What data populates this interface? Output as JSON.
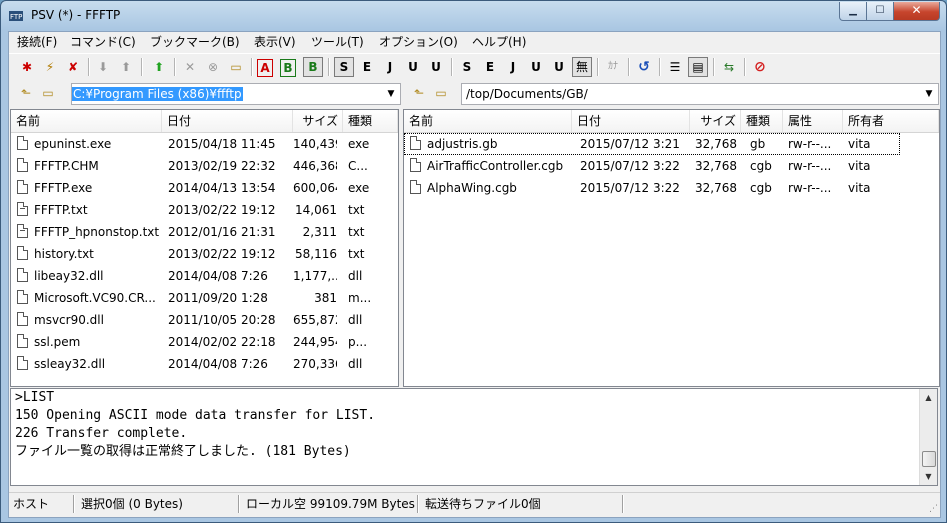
{
  "window": {
    "title": "PSV (*) - FFFTP"
  },
  "menu": [
    "接続(F)",
    "コマンド(C)",
    "ブックマーク(B)",
    "表示(V)",
    "ツール(T)",
    "オプション(O)",
    "ヘルプ(H)"
  ],
  "toolbar": {
    "glyphs": [
      "✱",
      "⚡",
      "✘",
      "⬇",
      "⬆",
      "⬆",
      "✕",
      "⊗",
      "▭",
      "A",
      "B",
      "B",
      "S",
      "E",
      "J",
      "U",
      "U",
      "S",
      "E",
      "J",
      "U",
      "U",
      "無",
      "ｶﾅ",
      "↺",
      "☰",
      "▤",
      "⇆",
      "⊘"
    ],
    "colors": {
      "connect": "#cc0000",
      "green": "#22a322",
      "refresh": "#1a4fb8",
      "stop": "#d42020"
    }
  },
  "local": {
    "path": "C:¥Program Files (x86)¥ffftp",
    "columns": {
      "name": "名前",
      "date": "日付",
      "size": "サイズ",
      "type": "種類"
    },
    "files": [
      {
        "name": "epuninst.exe",
        "date": "2015/04/18 11:45",
        "size": "140,439",
        "type": "exe",
        "icon": "file-icon"
      },
      {
        "name": "FFFTP.CHM",
        "date": "2013/02/19 22:32",
        "size": "446,368",
        "type": "C...",
        "icon": "file-icon"
      },
      {
        "name": "FFFTP.exe",
        "date": "2014/04/13 13:54",
        "size": "600,064",
        "type": "exe",
        "icon": "file-icon"
      },
      {
        "name": "FFFTP.txt",
        "date": "2013/02/22 19:12",
        "size": "14,061",
        "type": "txt",
        "icon": "text-file-icon"
      },
      {
        "name": "FFFTP_hpnonstop.txt",
        "date": "2012/01/16 21:31",
        "size": "2,311",
        "type": "txt",
        "icon": "text-file-icon"
      },
      {
        "name": "history.txt",
        "date": "2013/02/22 19:12",
        "size": "58,116",
        "type": "txt",
        "icon": "file-icon"
      },
      {
        "name": "libeay32.dll",
        "date": "2014/04/08  7:26",
        "size": "1,177,...",
        "type": "dll",
        "icon": "file-icon"
      },
      {
        "name": "Microsoft.VC90.CR...",
        "date": "2011/09/20  1:28",
        "size": "381",
        "type": "m...",
        "icon": "file-icon"
      },
      {
        "name": "msvcr90.dll",
        "date": "2011/10/05 20:28",
        "size": "655,872",
        "type": "dll",
        "icon": "file-icon"
      },
      {
        "name": "ssl.pem",
        "date": "2014/02/02 22:18",
        "size": "244,954",
        "type": "p...",
        "icon": "file-icon"
      },
      {
        "name": "ssleay32.dll",
        "date": "2014/04/08  7:26",
        "size": "270,336",
        "type": "dll",
        "icon": "file-icon"
      }
    ]
  },
  "remote": {
    "path": "/top/Documents/GB/",
    "columns": {
      "name": "名前",
      "date": "日付",
      "size": "サイズ",
      "type": "種類",
      "attr": "属性",
      "owner": "所有者"
    },
    "files": [
      {
        "name": "adjustris.gb",
        "date": "2015/07/12  3:21",
        "size": "32,768",
        "type": "gb",
        "attr": "rw-r--...",
        "owner": "vita"
      },
      {
        "name": "AirTrafficController.cgb",
        "date": "2015/07/12  3:22",
        "size": "32,768",
        "type": "cgb",
        "attr": "rw-r--...",
        "owner": "vita"
      },
      {
        "name": "AlphaWing.cgb",
        "date": "2015/07/12  3:22",
        "size": "32,768",
        "type": "cgb",
        "attr": "rw-r--...",
        "owner": "vita"
      }
    ]
  },
  "log": [
    ">LIST",
    "150 Opening ASCII mode data transfer for LIST.",
    "226 Transfer complete.",
    "ファイル一覧の取得は正常終了しました. (181 Bytes)"
  ],
  "status": {
    "host": "ホスト",
    "selected": "選択0個 (0 Bytes)",
    "local_free": "ローカル空 99109.79M Bytes",
    "queue": "転送待ちファイル0個"
  }
}
